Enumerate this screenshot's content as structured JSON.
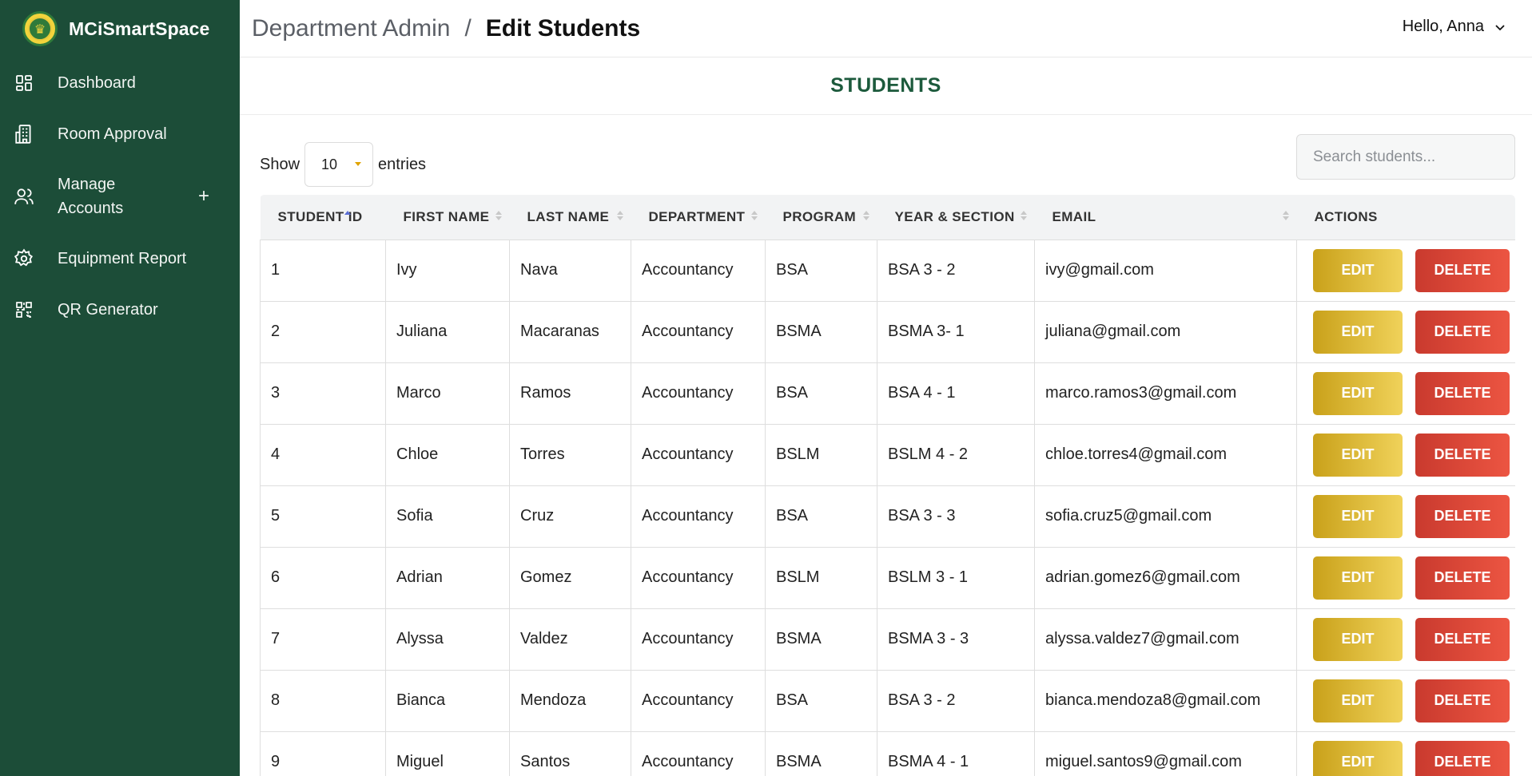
{
  "app": {
    "name": "MCiSmartSpace"
  },
  "sidebar": {
    "items": [
      {
        "label": "Dashboard",
        "icon": "dashboard-icon"
      },
      {
        "label": "Room Approval",
        "icon": "building-icon"
      },
      {
        "label": "Manage Accounts",
        "icon": "users-icon",
        "expand": "+"
      },
      {
        "label": "Equipment Report",
        "icon": "gear-icon"
      },
      {
        "label": "QR Generator",
        "icon": "qr-code-icon"
      }
    ]
  },
  "header": {
    "breadcrumb_parent": "Department Admin",
    "breadcrumb_sep": "/",
    "breadcrumb_current": "Edit Students",
    "user_greeting": "Hello, Anna"
  },
  "page": {
    "title": "STUDENTS"
  },
  "controls": {
    "show_label": "Show",
    "entries_value": "10",
    "entries_label": "entries",
    "search_placeholder": "Search students..."
  },
  "table": {
    "columns": [
      "STUDENT ID",
      "FIRST NAME",
      "LAST NAME",
      "DEPARTMENT",
      "PROGRAM",
      "YEAR & SECTION",
      "EMAIL",
      "ACTIONS"
    ],
    "edit_label": "EDIT",
    "delete_label": "DELETE",
    "rows": [
      [
        "1",
        "Ivy",
        "Nava",
        "Accountancy",
        "BSA",
        "BSA 3 - 2",
        "ivy@gmail.com"
      ],
      [
        "2",
        "Juliana",
        "Macaranas",
        "Accountancy",
        "BSMA",
        "BSMA 3- 1",
        "juliana@gmail.com"
      ],
      [
        "3",
        "Marco",
        "Ramos",
        "Accountancy",
        "BSA",
        "BSA 4 - 1",
        "marco.ramos3@gmail.com"
      ],
      [
        "4",
        "Chloe",
        "Torres",
        "Accountancy",
        "BSLM",
        "BSLM 4 - 2",
        "chloe.torres4@gmail.com"
      ],
      [
        "5",
        "Sofia",
        "Cruz",
        "Accountancy",
        "BSA",
        "BSA 3 - 3",
        "sofia.cruz5@gmail.com"
      ],
      [
        "6",
        "Adrian",
        "Gomez",
        "Accountancy",
        "BSLM",
        "BSLM 3 - 1",
        "adrian.gomez6@gmail.com"
      ],
      [
        "7",
        "Alyssa",
        "Valdez",
        "Accountancy",
        "BSMA",
        "BSMA 3 - 3",
        "alyssa.valdez7@gmail.com"
      ],
      [
        "8",
        "Bianca",
        "Mendoza",
        "Accountancy",
        "BSA",
        "BSA 3 - 2",
        "bianca.mendoza8@gmail.com"
      ],
      [
        "9",
        "Miguel",
        "Santos",
        "Accountancy",
        "BSMA",
        "BSMA 4 - 1",
        "miguel.santos9@gmail.com"
      ]
    ]
  },
  "colors": {
    "sidebar_bg": "#1c4d38",
    "heading_green": "#1c5a3c",
    "edit_gold": "#c9a11a",
    "delete_red": "#d9432f",
    "sort_active": "#5b6fd6"
  }
}
